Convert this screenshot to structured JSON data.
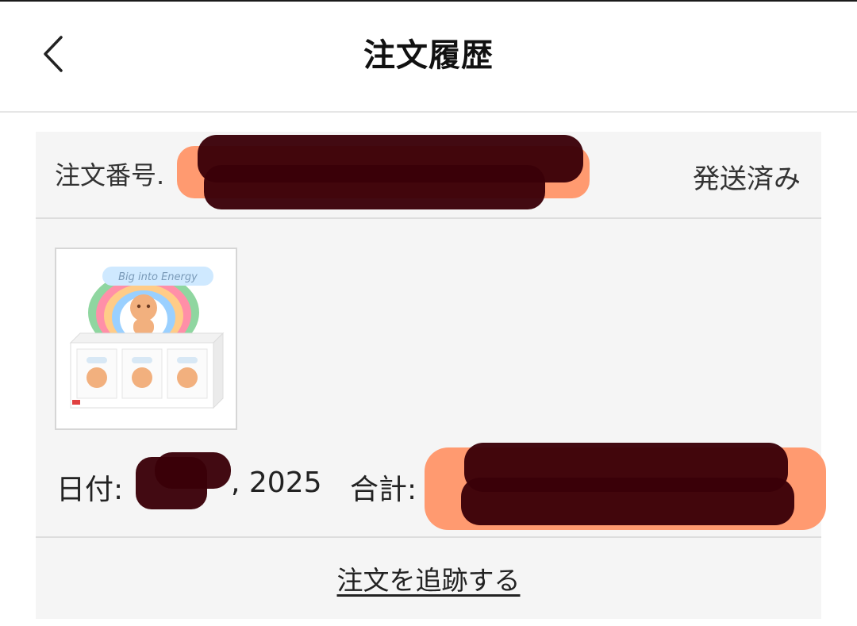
{
  "header": {
    "title": "注文履歴",
    "back_icon": "chevron-left-icon"
  },
  "order": {
    "number_label": "注文番号.",
    "status": "発送済み",
    "product_image_text": "Big into Energy",
    "date_label": "日付:",
    "date_year": ", 2025",
    "total_label": "合計:",
    "track_label": "注文を追跡する"
  },
  "colors": {
    "redaction_dark": "#3a0008",
    "redaction_glow": "#ff9a70",
    "card_background": "#f5f5f5"
  }
}
